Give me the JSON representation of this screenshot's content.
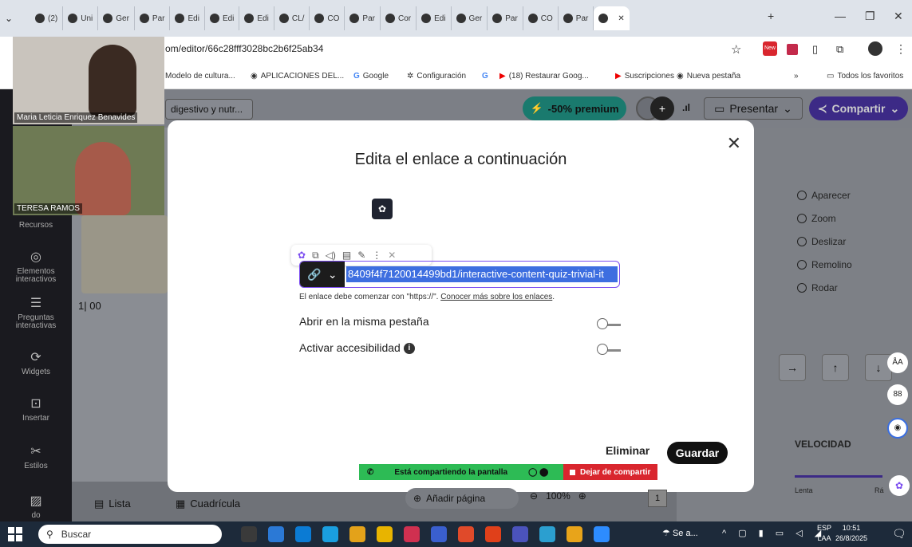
{
  "browser": {
    "tabs": [
      {
        "label": "(2)",
        "icon": "whatsapp-icon"
      },
      {
        "label": "Uni",
        "icon": "teams-icon"
      },
      {
        "label": "Ger",
        "icon": "chrome-icon"
      },
      {
        "label": "Par",
        "icon": "chrome-icon"
      },
      {
        "label": "Edi",
        "icon": "chrome-icon"
      },
      {
        "label": "Edi",
        "icon": "chrome-icon"
      },
      {
        "label": "Edi",
        "icon": "chrome-icon"
      },
      {
        "label": "CL/",
        "icon": "chrome-icon"
      },
      {
        "label": "CO",
        "icon": "chrome-icon"
      },
      {
        "label": "Par",
        "icon": "chrome-icon"
      },
      {
        "label": "Cor",
        "icon": "outlook-icon"
      },
      {
        "label": "Edi",
        "icon": "moodle-icon"
      },
      {
        "label": "Ger",
        "icon": "chrome-icon"
      },
      {
        "label": "Par",
        "icon": "chrome-icon"
      },
      {
        "label": "CO",
        "icon": "chrome-icon"
      },
      {
        "label": "Par",
        "icon": "chrome-icon"
      }
    ],
    "url": "om/editor/66c28fff3028bc2b6f25ab34",
    "bookmarks": [
      "Modelo de cultura...",
      "APLICACIONES DEL...",
      "Google",
      "Configuración",
      "(18) Restaurar Goog...",
      "Suscripciones",
      "Nueva pestaña"
    ],
    "all_bookmarks": "Todos los favoritos",
    "overflow": "»"
  },
  "video": {
    "person1": "Maria Leticia Enriquez Benavides",
    "person2": "TERESA RAMOS"
  },
  "header": {
    "doc_title": "digestivo y nutr...",
    "promo": "-50% premium",
    "present": "Presentar",
    "share": "Compartir"
  },
  "sidebar": [
    {
      "label": "Recursos",
      "icon": "folder-icon"
    },
    {
      "label": "Elementos interactivos",
      "icon": "touch-icon"
    },
    {
      "label": "Preguntas interactivas",
      "icon": "question-list-icon"
    },
    {
      "label": "Widgets",
      "icon": "puzzle-icon"
    },
    {
      "label": "Insertar",
      "icon": "insert-icon"
    },
    {
      "label": "Estilos",
      "icon": "styles-icon"
    },
    {
      "label": "do",
      "icon": "texture-icon"
    }
  ],
  "canvas": {
    "page_counter": "1| 00"
  },
  "modal": {
    "title": "Edita el enlace a continuación",
    "link_value": "8409f4f7120014499bd1/interactive-content-quiz-trivial-it",
    "hint": "El enlace debe comenzar con \"https://\".",
    "hint_link": "Conocer más sobre los enlaces",
    "option_same_tab": "Abrir en la misma pestaña",
    "option_accessibility": "Activar accesibilidad",
    "delete": "Eliminar",
    "save": "Guardar"
  },
  "share_banner": {
    "status": "Está compartiendo la pantalla",
    "stop": "Dejar de compartir"
  },
  "right_panel": {
    "animations": [
      "Aparecer",
      "Zoom",
      "Deslizar",
      "Remolino",
      "Rodar"
    ],
    "speed_label": "VELOCIDAD",
    "speed_slow": "Lenta",
    "speed_fast": "Rá"
  },
  "bottom": {
    "list": "Lista",
    "grid": "Cuadrícula",
    "add_page": "Añadir página",
    "zoom": "100%",
    "page": "1"
  },
  "taskbar": {
    "search": "Buscar",
    "weather": "Se a...",
    "lang": "ESP",
    "layout": "LAA",
    "time": "10:51",
    "date": "26/8/2025"
  }
}
